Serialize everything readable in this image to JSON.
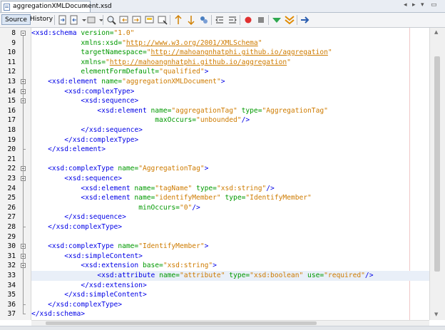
{
  "editor_tab": {
    "filename": "aggregationXMLDocument.xsd",
    "close_glyph": "×"
  },
  "window_controls": {
    "left": "◂",
    "right": "▸",
    "menu": "▾",
    "restore": "▭"
  },
  "toolbar": {
    "source_label": "Source",
    "history_label": "History"
  },
  "scroll_arrows": {
    "up": "▲",
    "down": "▼"
  },
  "gutter_numbers": [
    "8",
    "9",
    "10",
    "11",
    "12",
    "13",
    "14",
    "15",
    "16",
    "17",
    "18",
    "19",
    "20",
    "21",
    "22",
    "23",
    "24",
    "25",
    "26",
    "27",
    "28",
    "29",
    "30",
    "31",
    "32",
    "33",
    "34",
    "35",
    "36",
    "37"
  ],
  "code_lines": [
    [
      [
        "t",
        "<xsd:schema "
      ],
      [
        "a",
        "version="
      ],
      [
        "v",
        "\"1.0\""
      ]
    ],
    [
      [
        "p",
        "            "
      ],
      [
        "a",
        "xmlns:xsd="
      ],
      [
        "v",
        "\""
      ],
      [
        "u",
        "http://www.w3.org/2001/XMLSchema"
      ],
      [
        "v",
        "\""
      ]
    ],
    [
      [
        "p",
        "            "
      ],
      [
        "a",
        "targetNamespace="
      ],
      [
        "v",
        "\""
      ],
      [
        "u",
        "http://mahoangnhatphi.github.io/aggregation"
      ],
      [
        "v",
        "\""
      ]
    ],
    [
      [
        "p",
        "            "
      ],
      [
        "a",
        "xmlns="
      ],
      [
        "v",
        "\""
      ],
      [
        "u",
        "http://mahoangnhatphi.github.io/aggregation"
      ],
      [
        "v",
        "\""
      ]
    ],
    [
      [
        "p",
        "            "
      ],
      [
        "a",
        "elementFormDefault="
      ],
      [
        "v",
        "\"qualified\""
      ],
      [
        "t",
        ">"
      ]
    ],
    [
      [
        "p",
        "    "
      ],
      [
        "t",
        "<xsd:element "
      ],
      [
        "a",
        "name="
      ],
      [
        "v",
        "\"aggregationXMLDocument\""
      ],
      [
        "t",
        ">"
      ]
    ],
    [
      [
        "p",
        "        "
      ],
      [
        "t",
        "<xsd:complexType>"
      ]
    ],
    [
      [
        "p",
        "            "
      ],
      [
        "t",
        "<xsd:sequence>"
      ]
    ],
    [
      [
        "p",
        "                "
      ],
      [
        "t",
        "<xsd:element "
      ],
      [
        "a",
        "name="
      ],
      [
        "v",
        "\"aggregationTag\""
      ],
      [
        "p",
        " "
      ],
      [
        "a",
        "type="
      ],
      [
        "v",
        "\"AggregationTag\""
      ]
    ],
    [
      [
        "p",
        "                              "
      ],
      [
        "a",
        "maxOccurs="
      ],
      [
        "v",
        "\"unbounded\""
      ],
      [
        "t",
        "/>"
      ]
    ],
    [
      [
        "p",
        "            "
      ],
      [
        "t",
        "</xsd:sequence>"
      ]
    ],
    [
      [
        "p",
        "        "
      ],
      [
        "t",
        "</xsd:complexType>"
      ]
    ],
    [
      [
        "p",
        "    "
      ],
      [
        "t",
        "</xsd:element>"
      ]
    ],
    [],
    [
      [
        "p",
        "    "
      ],
      [
        "t",
        "<xsd:complexType "
      ],
      [
        "a",
        "name="
      ],
      [
        "v",
        "\"AggregationTag\""
      ],
      [
        "t",
        ">"
      ]
    ],
    [
      [
        "p",
        "        "
      ],
      [
        "t",
        "<xsd:sequence>"
      ]
    ],
    [
      [
        "p",
        "            "
      ],
      [
        "t",
        "<xsd:element "
      ],
      [
        "a",
        "name="
      ],
      [
        "v",
        "\"tagName\""
      ],
      [
        "p",
        " "
      ],
      [
        "a",
        "type="
      ],
      [
        "v",
        "\"xsd:string\""
      ],
      [
        "t",
        "/>"
      ]
    ],
    [
      [
        "p",
        "            "
      ],
      [
        "t",
        "<xsd:element "
      ],
      [
        "a",
        "name="
      ],
      [
        "v",
        "\"identifyMember\""
      ],
      [
        "p",
        " "
      ],
      [
        "a",
        "type="
      ],
      [
        "v",
        "\"IdentifyMember\""
      ]
    ],
    [
      [
        "p",
        "                          "
      ],
      [
        "a",
        "minOccurs="
      ],
      [
        "v",
        "\"0\""
      ],
      [
        "t",
        "/>"
      ]
    ],
    [
      [
        "p",
        "        "
      ],
      [
        "t",
        "</xsd:sequence>"
      ]
    ],
    [
      [
        "p",
        "    "
      ],
      [
        "t",
        "</xsd:complexType>"
      ]
    ],
    [],
    [
      [
        "p",
        "    "
      ],
      [
        "t",
        "<xsd:complexType "
      ],
      [
        "a",
        "name="
      ],
      [
        "v",
        "\"IdentifyMember\""
      ],
      [
        "t",
        ">"
      ]
    ],
    [
      [
        "p",
        "        "
      ],
      [
        "t",
        "<xsd:simpleContent>"
      ]
    ],
    [
      [
        "p",
        "            "
      ],
      [
        "t",
        "<xsd:extension "
      ],
      [
        "a",
        "base="
      ],
      [
        "v",
        "\"xsd:string\""
      ],
      [
        "t",
        ">"
      ]
    ],
    [
      [
        "p",
        "                "
      ],
      [
        "t",
        "<xsd:attribute "
      ],
      [
        "a",
        "name="
      ],
      [
        "v",
        "\"attribute\""
      ],
      [
        "p",
        " "
      ],
      [
        "a",
        "type="
      ],
      [
        "v",
        "\"xsd:boolean\""
      ],
      [
        "p",
        " "
      ],
      [
        "a",
        "use="
      ],
      [
        "v",
        "\"required\""
      ],
      [
        "t",
        "/>"
      ]
    ],
    [
      [
        "p",
        "            "
      ],
      [
        "t",
        "</xsd:extension>"
      ]
    ],
    [
      [
        "p",
        "        "
      ],
      [
        "t",
        "</xsd:simpleContent>"
      ]
    ],
    [
      [
        "p",
        "    "
      ],
      [
        "t",
        "</xsd:complexType>"
      ]
    ],
    [
      [
        "t",
        "</xsd:schema>"
      ]
    ]
  ],
  "highlighted_line": 33,
  "colors": {
    "tag": "#0000e6",
    "attribute": "#009900",
    "value": "#ce7b00",
    "current_line": "#e9eff8"
  }
}
